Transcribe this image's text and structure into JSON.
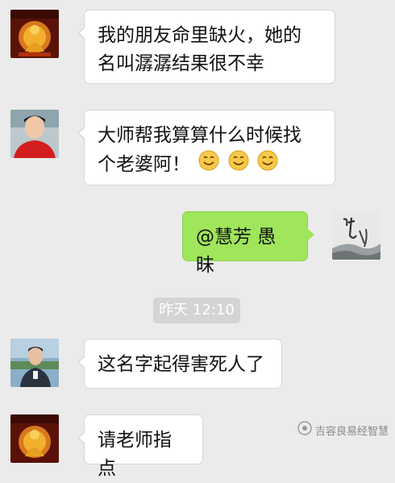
{
  "messages": [
    {
      "id": "msg1",
      "side": "left",
      "avatar": "buddha-avatar",
      "text_lines": [
        "我的朋友命里缺火，她的",
        "名叫潺潺结果很不幸"
      ]
    },
    {
      "id": "msg2",
      "side": "left",
      "avatar": "man-red-shirt-avatar",
      "text_lines": [
        "大师帮我算算什么时候找",
        "个老婆阿！"
      ],
      "emoji_count": 3,
      "emoji": "smiling-face-icon"
    },
    {
      "id": "msg3",
      "side": "right",
      "avatar": "calligraphy-avatar",
      "text": "@慧芳 愚昧"
    },
    {
      "id": "msg4",
      "side": "left",
      "avatar": "man-outdoor-avatar",
      "text": "这名字起得害死人了"
    },
    {
      "id": "msg5",
      "side": "left",
      "avatar": "buddha-avatar",
      "text": "请老师指点"
    }
  ],
  "timestamp": "昨天 12:10",
  "watermark": {
    "text": "吉容良易经智慧",
    "icon": "wechat-official-icon"
  },
  "colors": {
    "background": "#ebebeb",
    "bubble_left": "#ffffff",
    "bubble_right": "#9fe65b",
    "timestamp_bg": "#d4d4d4"
  }
}
